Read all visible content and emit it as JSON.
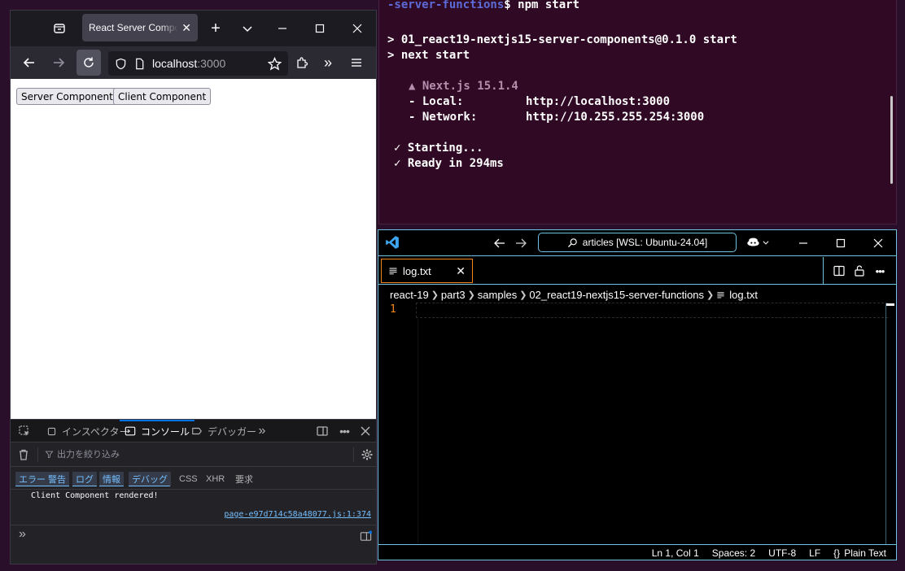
{
  "browser": {
    "tab_title": "React Server Components",
    "url_host": "localhost",
    "url_port": ":3000",
    "page": {
      "buttons": [
        "Server Component",
        "Client Component"
      ]
    },
    "devtools": {
      "tabs": [
        "インスペクター",
        "コンソール",
        "デバッガー"
      ],
      "filter_placeholder": "出力を絞り込み",
      "levels_on": [
        "エラー",
        "警告",
        "ログ",
        "情報",
        "デバッグ"
      ],
      "levels_off": [
        "CSS",
        "XHR",
        "要求"
      ],
      "log_message": "Client Component rendered!",
      "log_source": "page-e97d714c58a48077.js:1:374"
    }
  },
  "terminal": {
    "prompt_path": "-server-functions",
    "prompt_cmd": "$ npm start",
    "lines": [
      "> 01_react19-nextjs15-server-components@0.1.0 start",
      "> next start"
    ],
    "nextjs": "▲ Next.js 15.1.4",
    "local_label": "- Local:",
    "local_url": "http://localhost:3000",
    "network_label": "- Network:",
    "network_url": "http://10.255.255.254:3000",
    "starting": "✓ Starting...",
    "ready": "✓ Ready in 294ms",
    "colors": {
      "bg": "#300a24",
      "dim": "#b48ead",
      "path": "#5c6bd8"
    }
  },
  "vscode": {
    "search": "articles [WSL: Ubuntu-24.04]",
    "tab": "log.txt",
    "breadcrumbs": [
      "react-19",
      "part3",
      "samples",
      "02_react19-nextjs15-server-functions",
      "log.txt"
    ],
    "line_number": "1",
    "status": {
      "position": "Ln 1, Col 1",
      "spaces": "Spaces: 2",
      "encoding": "UTF-8",
      "eol": "LF",
      "language": "Plain Text",
      "language_icon": "{}"
    },
    "colors": {
      "border": "#6fc3df",
      "tab_border": "#f38518",
      "line_no": "#f38518"
    }
  }
}
